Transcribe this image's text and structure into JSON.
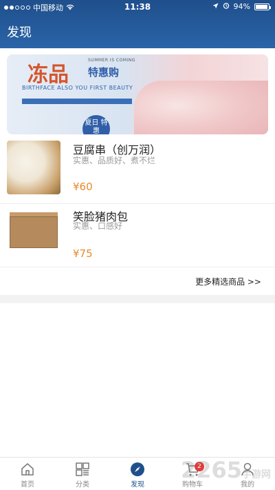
{
  "status_bar": {
    "carrier": "中国移动",
    "time": "11:38",
    "battery": "94%"
  },
  "nav": {
    "title": "发现"
  },
  "banner": {
    "title": "冻品",
    "subtitle": "特惠购",
    "tagline": "SUMMER IS COMING",
    "slogan": "BIRTHFACE ALSO YOU FIRST BEAUTY",
    "badge": "夏日 特惠"
  },
  "products": [
    {
      "name": "豆腐串（创万润）",
      "desc": "实惠、品质好、煮不烂",
      "price": "¥60"
    },
    {
      "name": "笑脸猪肉包",
      "desc": "实惠、口感好",
      "price": "¥75"
    }
  ],
  "more_link": "更多精选商品 >>",
  "tabs": [
    {
      "label": "首页",
      "icon": "home-icon"
    },
    {
      "label": "分类",
      "icon": "grid-icon"
    },
    {
      "label": "发现",
      "icon": "compass-icon"
    },
    {
      "label": "购物车",
      "icon": "cart-icon",
      "badge": "2"
    },
    {
      "label": "我的",
      "icon": "person-icon"
    }
  ],
  "watermark": {
    "text": "2265",
    "sub": "手游网"
  },
  "colors": {
    "primary": "#1f4f8c",
    "price": "#e88a2a",
    "badge": "#e23b3b"
  }
}
